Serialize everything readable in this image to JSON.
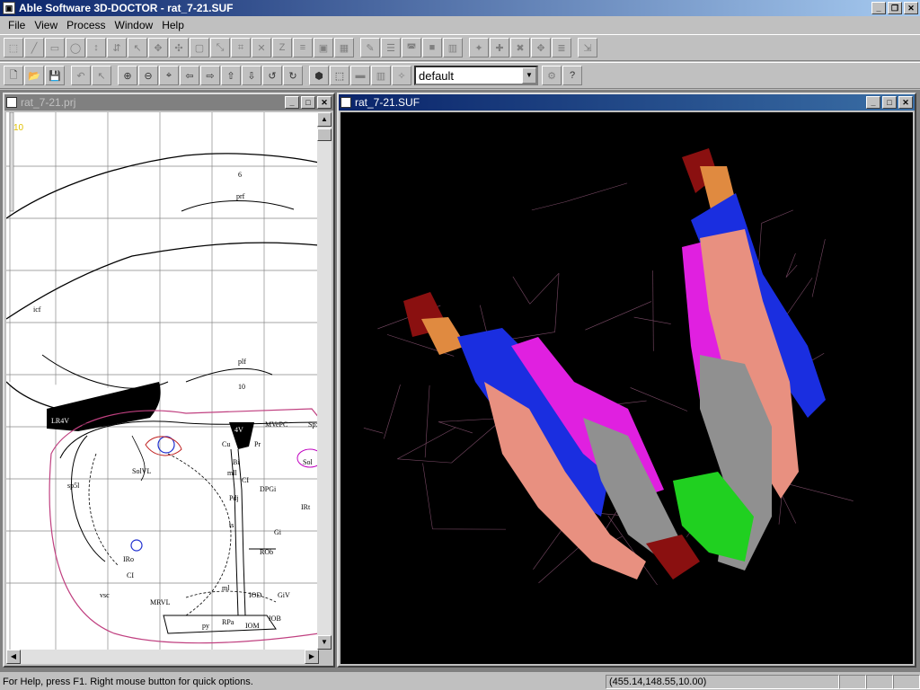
{
  "app": {
    "title": "Able Software 3D-DOCTOR - rat_7-21.SUF"
  },
  "menu": [
    {
      "label": "File",
      "key": "F"
    },
    {
      "label": "View",
      "key": "V"
    },
    {
      "label": "Process",
      "key": "P"
    },
    {
      "label": "Window",
      "key": "W"
    },
    {
      "label": "Help",
      "key": "H"
    }
  ],
  "toolbar2": {
    "render_combo_value": "default"
  },
  "windows": {
    "left": {
      "title": "rat_7-21.prj",
      "slice_label": "10"
    },
    "right": {
      "title": "rat_7-21.SUF"
    }
  },
  "atlas_labels": [
    "6",
    "prf",
    "icf",
    "plf",
    "10",
    "LR4V",
    "icp",
    "4V",
    "MVePC",
    "SolVL",
    "Sp5",
    "Cu",
    "Pr",
    "Bi",
    "mll",
    "CI",
    "Sol",
    "DPGi",
    "Pdj",
    "IRt",
    "sp5l",
    "ts",
    "Gi",
    "ROb",
    "IRo",
    "CI",
    "ml",
    "IOD",
    "GiV",
    "MRVL",
    "vsc",
    "py",
    "RPa",
    "IOM",
    "IOB"
  ],
  "colors": {
    "mesh": "#7a4a66",
    "blue": "#1a2ee0",
    "magenta": "#e020e0",
    "salmon": "#e89080",
    "gray": "#909090",
    "orange": "#e08a40",
    "darkred": "#8a1010",
    "green": "#20d020"
  },
  "status": {
    "message": "For Help, press F1. Right mouse button for quick options.",
    "coords": "(455.14,148.55,10.00)"
  }
}
